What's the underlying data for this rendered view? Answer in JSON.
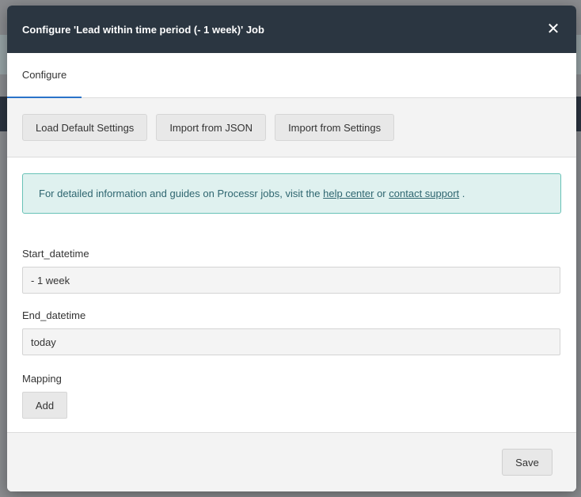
{
  "modal": {
    "title": "Configure 'Lead within time period (- 1 week)' Job",
    "close_glyph": "✕"
  },
  "tabs": [
    {
      "label": "Configure",
      "active": true
    }
  ],
  "toolbar": {
    "load_default_label": "Load Default Settings",
    "import_json_label": "Import from JSON",
    "import_settings_label": "Import from Settings"
  },
  "info": {
    "text_before": "For detailed information and guides on Processr jobs, visit the ",
    "help_link": "help center",
    "text_middle": " or ",
    "support_link": "contact support",
    "text_after": " ."
  },
  "fields": {
    "start": {
      "label": "Start_datetime",
      "value": "- 1 week"
    },
    "end": {
      "label": "End_datetime",
      "value": "today"
    }
  },
  "mapping": {
    "label": "Mapping",
    "add_label": "Add"
  },
  "footer": {
    "save_label": "Save"
  },
  "colors": {
    "header_bg": "#2b3641",
    "tab_accent": "#2a73c9",
    "info_bg": "#dff1ef",
    "info_border": "#68c2b7"
  }
}
